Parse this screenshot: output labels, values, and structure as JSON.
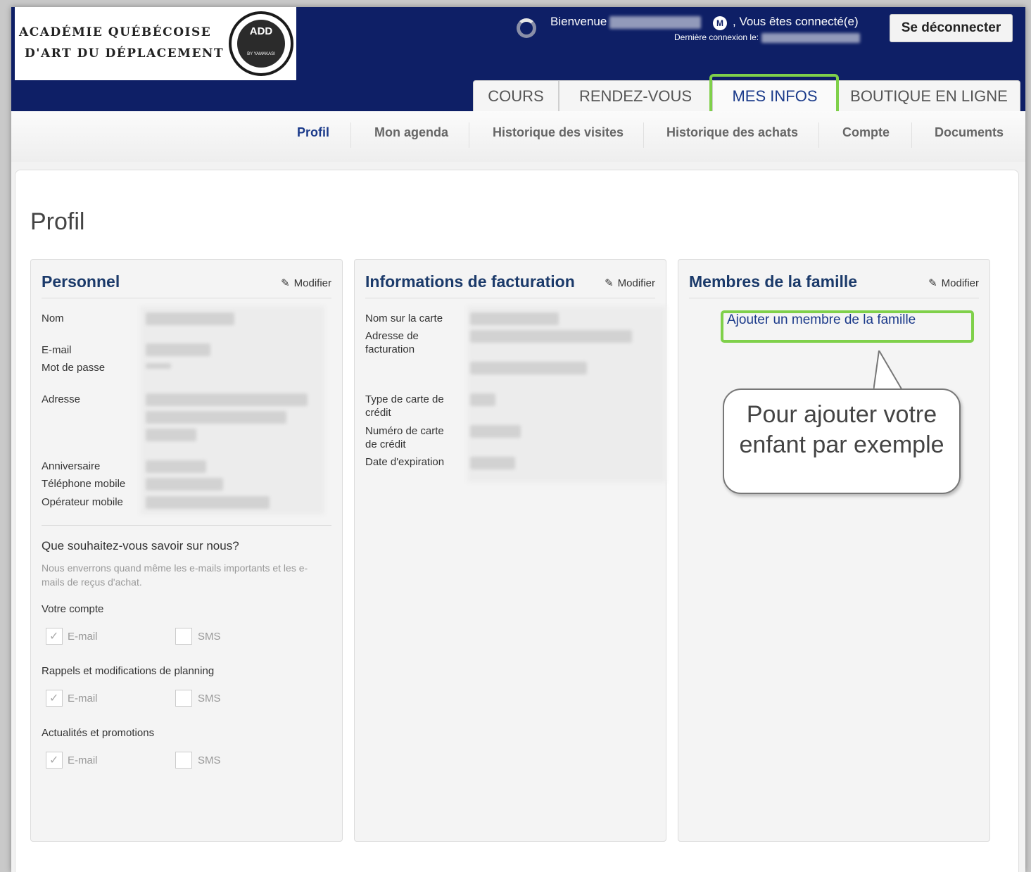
{
  "brand": {
    "line1": "ACADÉMIE QUÉBÉCOISE",
    "line2": "D'ART DU DÉPLACEMENT",
    "emblem_text": "ADD",
    "emblem_sub": "BY YAMAKASI"
  },
  "header": {
    "welcome": "Bienvenue",
    "badge": "M",
    "connected": ", Vous êtes connecté(e)",
    "last_login": "Dernière connexion le:",
    "logout": "Se déconnecter"
  },
  "tabs": [
    {
      "label": "COURS"
    },
    {
      "label": "RENDEZ-VOUS"
    },
    {
      "label": "MES INFOS"
    },
    {
      "label": "BOUTIQUE EN LIGNE"
    }
  ],
  "subnav": [
    {
      "label": "Profil"
    },
    {
      "label": "Mon agenda"
    },
    {
      "label": "Historique des visites"
    },
    {
      "label": "Historique des achats"
    },
    {
      "label": "Compte"
    },
    {
      "label": "Documents"
    }
  ],
  "page_title": "Profil",
  "personal": {
    "title": "Personnel",
    "edit": "Modifier",
    "labels": {
      "nom": "Nom",
      "email": "E-mail",
      "password": "Mot de passe",
      "address": "Adresse",
      "birthday": "Anniversaire",
      "mobile": "Téléphone mobile",
      "carrier": "Opérateur mobile"
    },
    "prefs_title": "Que souhaitez-vous savoir sur nous?",
    "prefs_hint": "Nous enverrons quand même les e-mails importants et les e-mails de reçus d'achat.",
    "groups": [
      {
        "label": "Votre compte",
        "email": "E-mail",
        "sms": "SMS"
      },
      {
        "label": "Rappels et modifications de planning",
        "email": "E-mail",
        "sms": "SMS"
      },
      {
        "label": "Actualités et promotions",
        "email": "E-mail",
        "sms": "SMS"
      }
    ]
  },
  "billing": {
    "title": "Informations de facturation",
    "edit": "Modifier",
    "labels": {
      "card_name": "Nom sur la carte",
      "billing_address_1": "Adresse de",
      "billing_address_2": "facturation",
      "card_type_1": "Type de carte de",
      "card_type_2": "crédit",
      "card_number_1": "Numéro de carte",
      "card_number_2": "de crédit",
      "expiry": "Date d'expiration"
    }
  },
  "family": {
    "title": "Membres de la famille",
    "edit": "Modifier",
    "add_link": "Ajouter un membre de la famille",
    "callout": "Pour ajouter votre enfant par exemple"
  },
  "colors": {
    "header_bg": "#0e1f66",
    "title_blue": "#1b3a6a",
    "highlight_green": "#7fd04a"
  }
}
